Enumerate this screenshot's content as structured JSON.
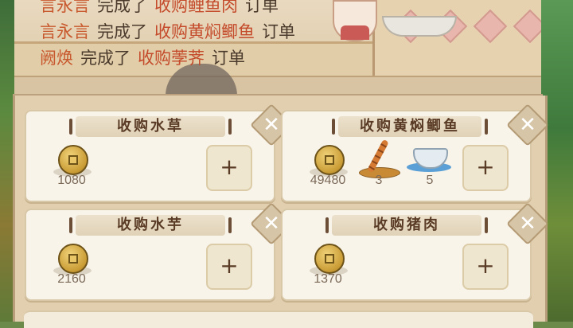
{
  "order_log": [
    {
      "who": "言永言",
      "action": "完成了",
      "item": "收购鲤鱼肉",
      "suffix": "订单"
    },
    {
      "who": "言永言",
      "action": "完成了",
      "item": "收购黄焖鲫鱼",
      "suffix": "订单"
    },
    {
      "who": "阙焕",
      "action": "完成了",
      "item": "收购荸荠",
      "suffix": "订单"
    }
  ],
  "orders": [
    {
      "title": "收购水草",
      "rewards": [
        {
          "icon": "copper-coin-icon",
          "count": "1080"
        }
      ]
    },
    {
      "title": "收购黄焖鲫鱼",
      "rewards": [
        {
          "icon": "copper-coin-icon",
          "count": "49480"
        },
        {
          "icon": "skewer-icon",
          "count": "3"
        },
        {
          "icon": "silver-ingot-icon",
          "count": "5"
        }
      ]
    },
    {
      "title": "收购水芋",
      "rewards": [
        {
          "icon": "copper-coin-icon",
          "count": "2160"
        }
      ]
    },
    {
      "title": "收购猪肉",
      "rewards": [
        {
          "icon": "copper-coin-icon",
          "count": "1370"
        }
      ]
    }
  ],
  "colors": {
    "name_accent": "#c8582d",
    "item_accent": "#c44b2b",
    "card_bg": "#f8f4ea"
  }
}
